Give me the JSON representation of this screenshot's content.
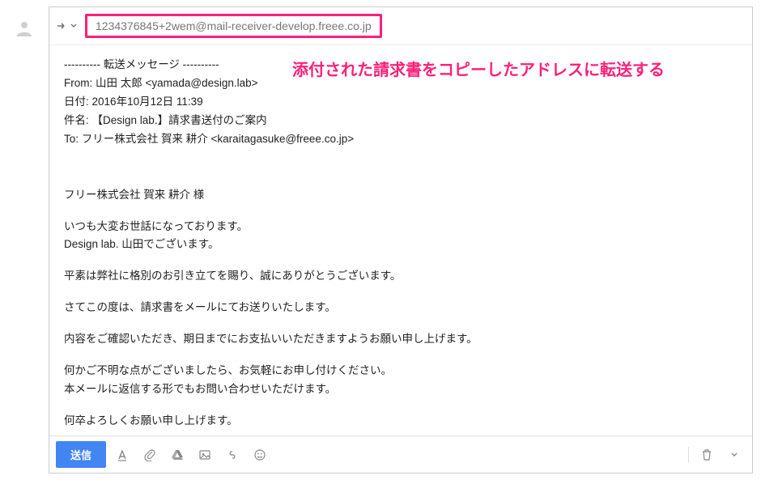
{
  "to_address": "1234376845+2wem@mail-receiver-develop.freee.co.jp",
  "annotation": "添付された請求書をコピーしたアドレスに転送する",
  "header": {
    "divider": "---------- 転送メッセージ ----------",
    "from_label": "From:",
    "from_value": "山田 太郎 <yamada@design.lab>",
    "date_label": "日付:",
    "date_value": "2016年10月12日 11:39",
    "subject_label": "件名:",
    "subject_value": "【Design lab.】請求書送付のご案内",
    "to_label": "To:",
    "to_value": "フリー株式会社 賀来 耕介 <karaitagasuke@freee.co.jp>"
  },
  "body": {
    "greeting": "フリー株式会社 賀来 耕介 様",
    "p1a": "いつも大変お世話になっております。",
    "p1b": "Design lab. 山田でございます。",
    "p2": "平素は弊社に格別のお引き立てを賜り、誠にありがとうございます。",
    "p3": "さてこの度は、請求書をメールにてお送りいたします。",
    "p4": "内容をご確認いただき、期日までにお支払いいただきますようお願い申し上げます。",
    "p5a": "何かご不明な点がございましたら、お気軽にお申し付けください。",
    "p5b": "本メールに返信する形でもお問い合わせいただけます。",
    "p6": "何卒よろしくお願い申し上げます。"
  },
  "toolbar": {
    "send": "送信"
  }
}
